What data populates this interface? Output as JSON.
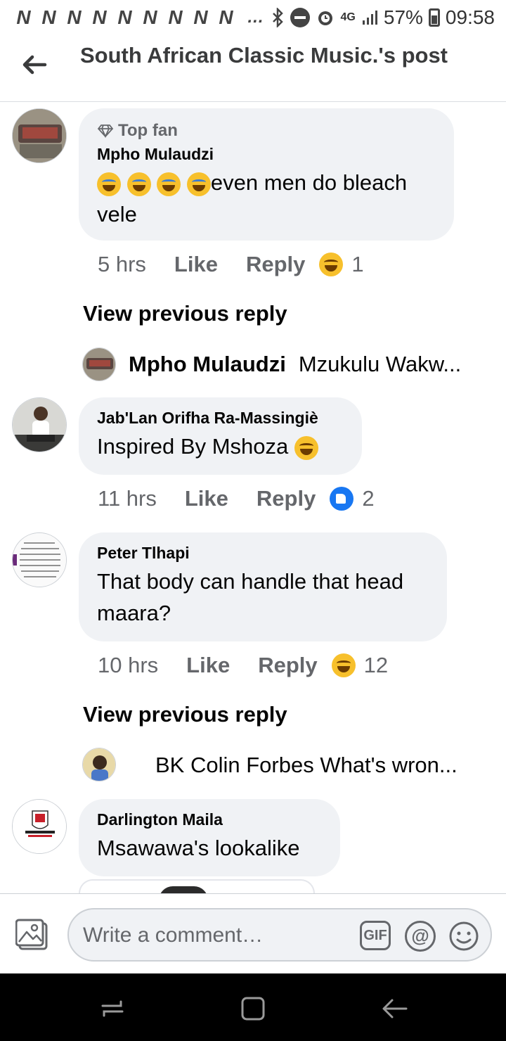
{
  "status_bar": {
    "notifications": [
      "N",
      "N",
      "N",
      "N",
      "N",
      "N",
      "N",
      "N",
      "N"
    ],
    "more": "…",
    "network": "4G",
    "battery": "57%",
    "time": "09:58"
  },
  "header": {
    "title": "South African Classic Music.'s post"
  },
  "comments": [
    {
      "badge": "Top fan",
      "author": "Mpho Mulaudzi",
      "text": "even men do bleach vele",
      "time": "5 hrs",
      "like": "Like",
      "reply": "Reply",
      "reaction_count": "1"
    },
    {
      "author": "Jab'Lan Orifha Ra-Massingiè",
      "text": "Inspired By Mshoza",
      "time": "11 hrs",
      "like": "Like",
      "reply": "Reply",
      "reaction_count": "2"
    },
    {
      "author": "Peter Tlhapi",
      "text": "That body can handle that head maara?",
      "time": "10 hrs",
      "like": "Like",
      "reply": "Reply",
      "reaction_count": "12"
    },
    {
      "author": "Darlington Maila",
      "text": "Msawawa's lookalike"
    }
  ],
  "replies": [
    {
      "view_previous": "View previous reply",
      "name": "Mpho Mulaudzi",
      "snippet": "Mzukulu Wakw..."
    },
    {
      "view_previous": "View previous reply",
      "name": "",
      "snippet": "BK Colin Forbes What's wron..."
    }
  ],
  "composer": {
    "placeholder": "Write a comment…",
    "gif_label": "GIF",
    "at_label": "@"
  },
  "icons": {
    "back": "back-arrow-icon",
    "photo": "photo-icon",
    "gif": "gif-icon",
    "mention": "at-icon",
    "emoji": "emoji-icon"
  }
}
